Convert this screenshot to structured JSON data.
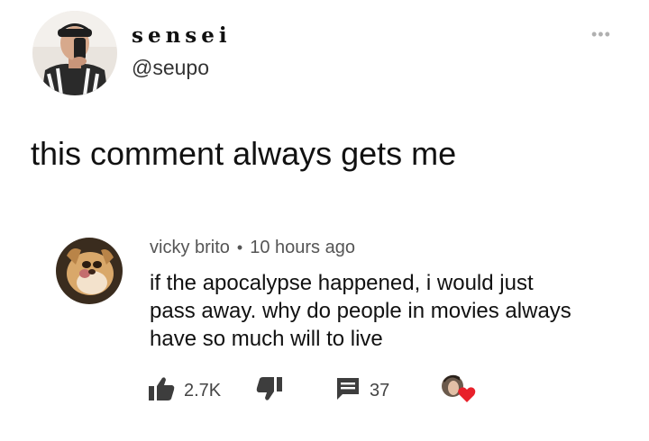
{
  "header": {
    "display_name": "sensei",
    "handle": "@seupo",
    "more_icon": "more-horizontal-icon"
  },
  "tweet": {
    "text": "this comment always gets me"
  },
  "comment": {
    "author": "vicky brito",
    "separator": "•",
    "time": "10 hours ago",
    "lines": [
      "if the apocalypse happened, i would just",
      "pass away. why do people in movies always",
      "have so much will to live"
    ],
    "likes": "2.7K",
    "replies": "37",
    "icons": {
      "like": "thumbs-up-icon",
      "dislike": "thumbs-down-icon",
      "reply": "comment-icon",
      "creator_heart": "heart-icon"
    },
    "colors": {
      "heart": "#e8202a"
    }
  }
}
